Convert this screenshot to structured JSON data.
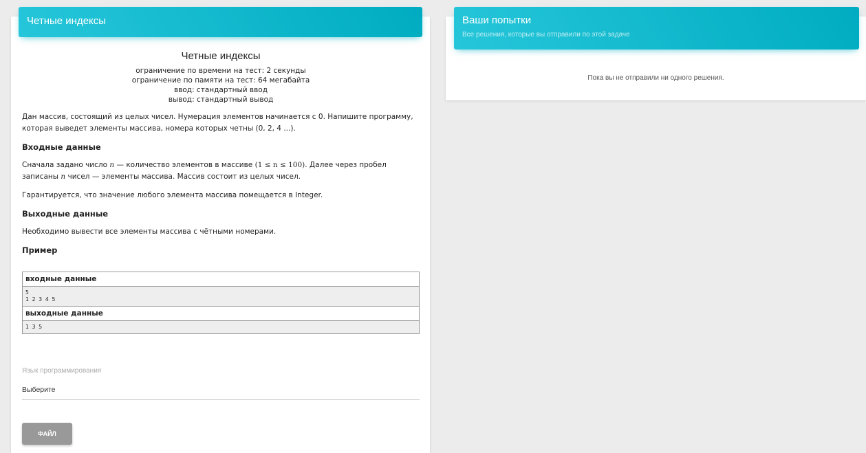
{
  "left_panel": {
    "header_title": "Четные индексы",
    "problem": {
      "title": "Четные индексы",
      "time_limit": "ограничение по времени на тест: 2 секунды",
      "memory_limit": "ограничение по памяти на тест: 64 мегабайта",
      "input": "ввод: стандартный ввод",
      "output": "вывод: стандартный вывод",
      "statement": "Дан массив, состоящий из целых чисел. Нумерация элементов начинается с 0. Напишите программу, которая выведет элементы массива, номера которых четны (0, 2, 4 ...).",
      "input_heading": "Входные данные",
      "input_text_1": "Сначала задано число",
      "input_var_n": "n",
      "input_text_2": "— количество элементов в массиве",
      "input_constraint": "(1 ≤ n ≤ 100)",
      "input_text_3": ". Далее через пробел записаны",
      "input_var_n2": "n",
      "input_text_4": "чисел — элементы массива. Массив состоит из целых чисел.",
      "guarantee": "Гарантируется, что значение любого элемента массива помещается в Integer.",
      "output_heading": "Выходные данные",
      "output_text": "Необходимо вывести все элементы массива с чётными номерами.",
      "example_heading": "Пример",
      "sample_input_label": "входные данные",
      "sample_input": "5\n1 2 3 4 5",
      "sample_output_label": "выходные данные",
      "sample_output": "1 3 5"
    },
    "language_label": "Язык программирования",
    "language_select": "Выберите",
    "file_button": "ФАЙЛ"
  },
  "right_panel": {
    "header_title": "Ваши попытки",
    "header_subtitle": "Все решения, которые вы отправили по этой задаче",
    "empty_message": "Пока вы не отправили ни одного решения."
  },
  "colors": {
    "accent_start": "#26c6da",
    "accent_end": "#00acc1",
    "background": "#ececec",
    "button": "#999999"
  }
}
